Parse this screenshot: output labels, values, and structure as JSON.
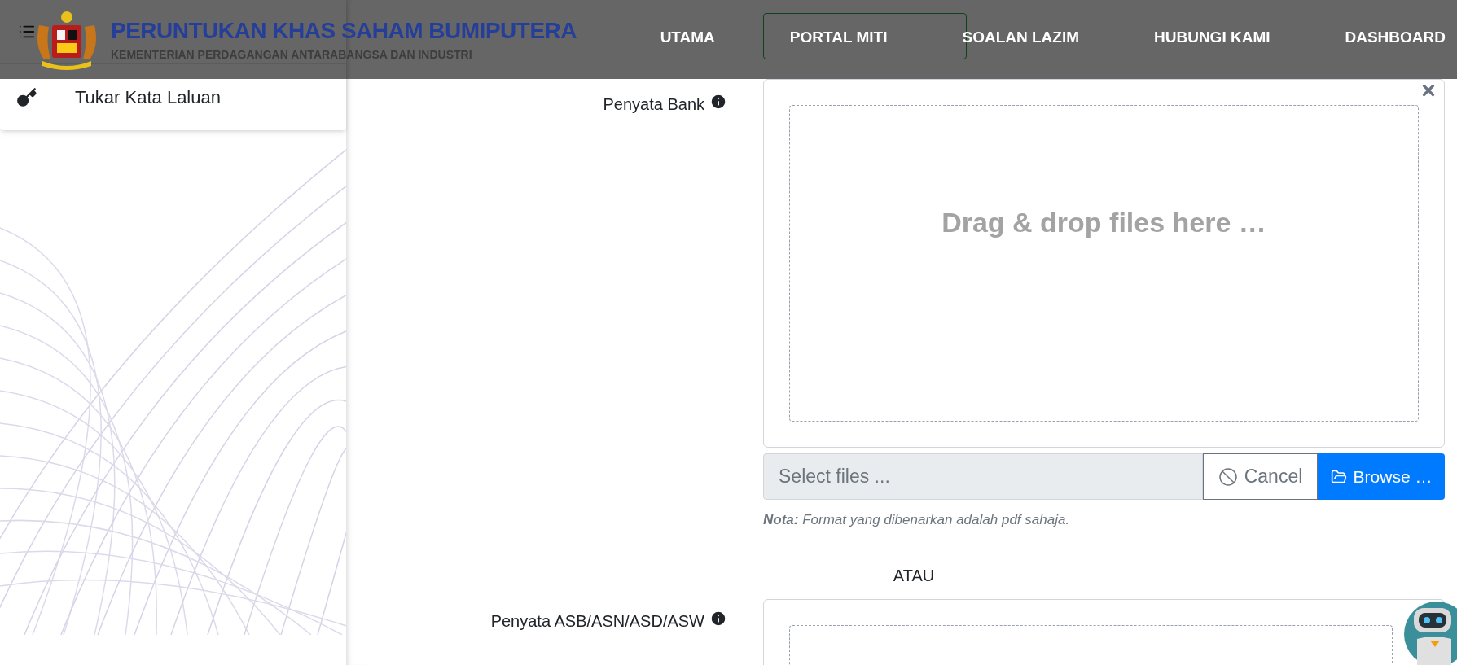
{
  "header": {
    "title": "PERUNTUKAN KHAS SAHAM BUMIPUTERA",
    "subtitle": "KEMENTERIAN PERDAGANGAN ANTARABANGSA DAN INDUSTRI",
    "nav": [
      {
        "label": "UTAMA"
      },
      {
        "label": "PORTAL MITI"
      },
      {
        "label": "SOALAN LAZIM"
      },
      {
        "label": "HUBUNGI KAMI"
      },
      {
        "label": "DASHBOARD"
      }
    ]
  },
  "sidebar": {
    "items": [
      {
        "label": "Tukar Kata Laluan"
      }
    ]
  },
  "bank_statement": {
    "label": "Penyata Bank",
    "dropzone": "Drag & drop files here …",
    "placeholder": "Select files ...",
    "cancel": {
      "label": "Cancel",
      "disabled": true
    },
    "browse": "Browse …",
    "note": "**Nota:** Format yang dibenarkan adalah pdf sahaja."
  },
  "or_label": "ATAU",
  "asb_statement": {
    "label": "Penyata ASB/ASN/ASD/ASW"
  }
}
